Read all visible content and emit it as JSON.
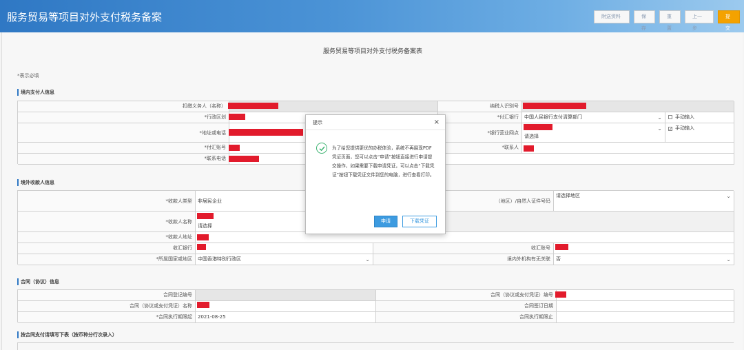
{
  "header": {
    "title": "服务贸易等项目对外支付税务备案",
    "buttons": [
      "附送资料",
      "保存",
      "重置",
      "上一步",
      "提交"
    ]
  },
  "form": {
    "doc_title": "服务贸易等项目对外支付税务备案表",
    "required_note": "*表示必填",
    "section1": {
      "title": "境内支付人信息",
      "labels": {
        "taxpayer_name": "扣缴义务人（名称）",
        "taxpayer_id": "纳税人识别号",
        "region": "*行政区划",
        "payer_bank": "*付汇银行",
        "address": "*地址或电话",
        "bank_branch": "*银行营业网点",
        "account": "*付汇账号",
        "contact": "*联系人",
        "phone": "*联系电话"
      },
      "payer_bank_value": "中国人民银行支付清算部门",
      "bank_branch_value": "请选择",
      "manual1": "手动输入",
      "manual2": "手动输入"
    },
    "section2": {
      "title": "境外收款人信息",
      "labels": {
        "payee_type": "*收款人类型",
        "id_type": "（地区）/自然人证件号码",
        "payee_name": "*收款人名称",
        "payee_address": "*收款人地址",
        "bank": "收汇银行",
        "bank_account": "收汇账号",
        "country": "*所属国家或地区",
        "related": "境内外机构有无关联"
      },
      "payee_type_value": "非居民企业",
      "id_type_value": "请选择地区",
      "payee_name_value": "请选择",
      "country_value": "中国香港特别行政区",
      "related_value": "否"
    },
    "section3": {
      "title": "合同（协议）信息",
      "labels": {
        "reg_no": "合同登记编号",
        "contract_no": "合同（协议或支付凭证）编号",
        "contract_name": "合同（协议或支付凭证）名称",
        "sign_date": "合同签订日期",
        "exec_start": "*合同执行期限起",
        "exec_end": "合同执行期限止"
      },
      "exec_start_value": "2021-08-25"
    },
    "section4": {
      "title": "按合同支付请填写下表（按币种分行次录入）"
    }
  },
  "dialog": {
    "title": "提示",
    "close": "×",
    "message": "为了给您提供更优的办税体验，系统不再展现PDF凭证页面，您可以点击“申请”按钮直接进行申请提交操作，如果需要下载申请凭证，可以点击“下载凭证”按钮下载凭证文件到您的电脑，进行查看打印。",
    "apply_button": "申请",
    "download_button": "下载凭证"
  }
}
